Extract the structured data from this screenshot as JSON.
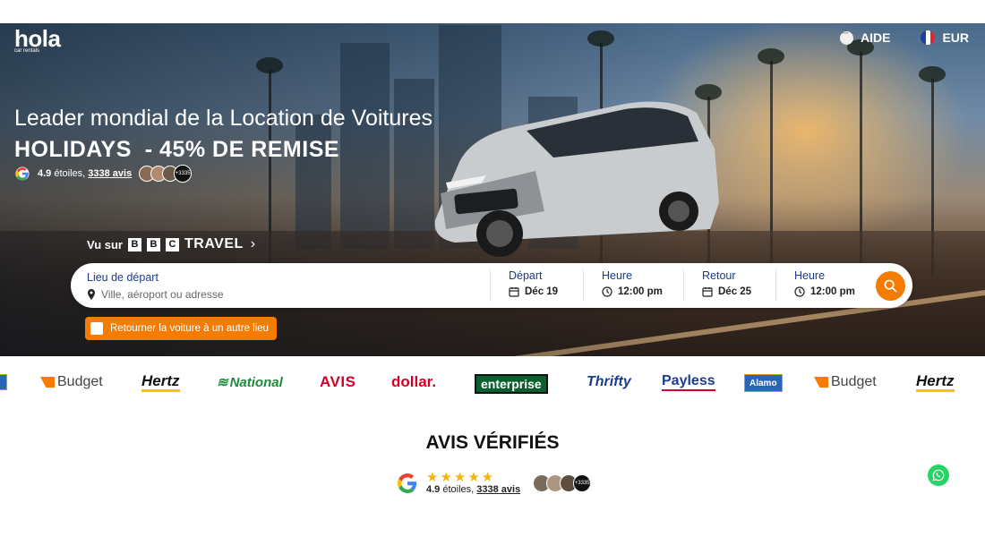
{
  "header": {
    "logo_text": "hola",
    "logo_sub": "car rentals",
    "nav": [
      {
        "label": "AIDE",
        "icon": "chat-icon"
      },
      {
        "label": "EUR",
        "icon": "france-flag-icon"
      }
    ]
  },
  "hero": {
    "headline": "Leader mondial de la Location de Voitures",
    "promo": "HOLIDAYS  - 45% DE REMISE",
    "rating": {
      "score": "4.9",
      "score_suffix": " étoiles, ",
      "count": "3338 avis",
      "avatar_count": "+3335"
    },
    "featured": {
      "prefix": "Vu sur",
      "letters": [
        "B",
        "B",
        "C"
      ],
      "suffix": "TRAVEL"
    }
  },
  "search": {
    "pickup": {
      "label": "Lieu de départ",
      "placeholder": "Ville, aéroport ou adresse"
    },
    "departure_date": {
      "label": "Départ",
      "value": "Déc 19"
    },
    "departure_time": {
      "label": "Heure",
      "value": "12:00 pm"
    },
    "return_date": {
      "label": "Retour",
      "value": "Déc 25"
    },
    "return_time": {
      "label": "Heure",
      "value": "12:00 pm"
    },
    "return_other_location": "Retourner la voiture à un autre lieu"
  },
  "brands": [
    "Budget",
    "Hertz",
    "National",
    "AVIS",
    "dollar.",
    "enterprise",
    "Thrifty",
    "Payless",
    "Alamo",
    "Budget",
    "Hertz"
  ],
  "reviews": {
    "title": "AVIS VÉRIFIÉS",
    "stars": "★★★★★",
    "score": "4.9",
    "score_suffix": " étoiles, ",
    "count": "3338 avis",
    "avatar_count": "+3335"
  },
  "colors": {
    "accent": "#f57c00",
    "label_blue": "#1d3a8a",
    "whatsapp": "#25d366"
  }
}
